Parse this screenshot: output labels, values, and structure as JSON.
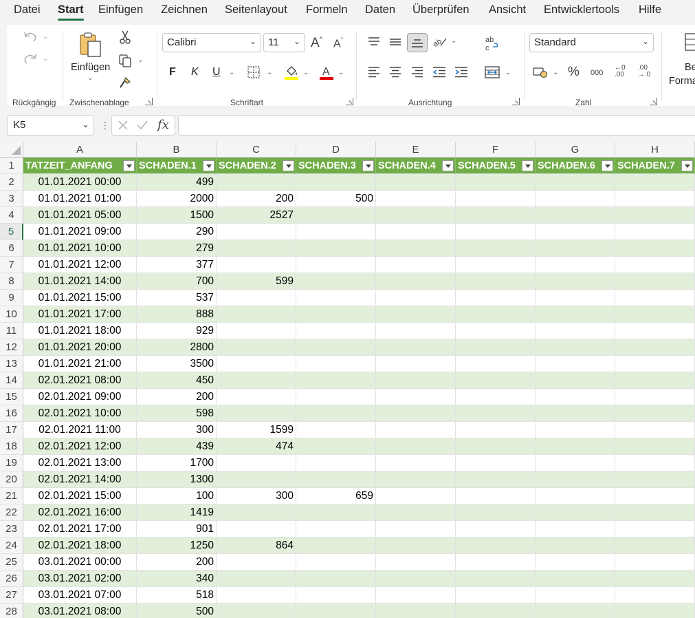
{
  "menu": {
    "tabs": [
      "Datei",
      "Start",
      "Einfügen",
      "Zeichnen",
      "Seitenlayout",
      "Formeln",
      "Daten",
      "Überprüfen",
      "Ansicht",
      "Entwicklertools",
      "Hilfe"
    ],
    "active": "Start"
  },
  "ribbon": {
    "groups": {
      "undo": "Rückgängig",
      "clipboard": "Zwischenablage",
      "font": "Schriftart",
      "alignment": "Ausrichtung",
      "number": "Zahl"
    },
    "paste_label": "Einfügen",
    "font_name": "Calibri",
    "font_size": "11",
    "number_format": "Standard",
    "format_partial_1": "Be",
    "format_partial_2": "Forma",
    "bold": "F",
    "italic": "K",
    "underline": "U",
    "fill_color": "#ffff00",
    "font_color": "#e00000"
  },
  "formula_bar": {
    "name_box": "K5",
    "formula": ""
  },
  "sheet": {
    "columns": [
      "A",
      "B",
      "C",
      "D",
      "E",
      "F",
      "G",
      "H"
    ],
    "headers": [
      "TATZEIT_ANFANG",
      "SCHADEN.1",
      "SCHADEN.2",
      "SCHADEN.3",
      "SCHADEN.4",
      "SCHADEN.5",
      "SCHADEN.6",
      "SCHADEN.7"
    ],
    "selected_row": 5,
    "header_color": "#70ad47",
    "band_color": "#e2efda",
    "rows": [
      {
        "n": "2",
        "a": "01.01.2021 00:00",
        "b": "499",
        "c": "",
        "d": ""
      },
      {
        "n": "3",
        "a": "01.01.2021 01:00",
        "b": "2000",
        "c": "200",
        "d": "500"
      },
      {
        "n": "4",
        "a": "01.01.2021 05:00",
        "b": "1500",
        "c": "2527",
        "d": ""
      },
      {
        "n": "5",
        "a": "01.01.2021 09:00",
        "b": "290",
        "c": "",
        "d": ""
      },
      {
        "n": "6",
        "a": "01.01.2021 10:00",
        "b": "279",
        "c": "",
        "d": ""
      },
      {
        "n": "7",
        "a": "01.01.2021 12:00",
        "b": "377",
        "c": "",
        "d": ""
      },
      {
        "n": "8",
        "a": "01.01.2021 14:00",
        "b": "700",
        "c": "599",
        "d": ""
      },
      {
        "n": "9",
        "a": "01.01.2021 15:00",
        "b": "537",
        "c": "",
        "d": ""
      },
      {
        "n": "10",
        "a": "01.01.2021 17:00",
        "b": "888",
        "c": "",
        "d": ""
      },
      {
        "n": "11",
        "a": "01.01.2021 18:00",
        "b": "929",
        "c": "",
        "d": ""
      },
      {
        "n": "12",
        "a": "01.01.2021 20:00",
        "b": "2800",
        "c": "",
        "d": ""
      },
      {
        "n": "13",
        "a": "01.01.2021 21:00",
        "b": "3500",
        "c": "",
        "d": ""
      },
      {
        "n": "14",
        "a": "02.01.2021 08:00",
        "b": "450",
        "c": "",
        "d": ""
      },
      {
        "n": "15",
        "a": "02.01.2021 09:00",
        "b": "200",
        "c": "",
        "d": ""
      },
      {
        "n": "16",
        "a": "02.01.2021 10:00",
        "b": "598",
        "c": "",
        "d": ""
      },
      {
        "n": "17",
        "a": "02.01.2021 11:00",
        "b": "300",
        "c": "1599",
        "d": ""
      },
      {
        "n": "18",
        "a": "02.01.2021 12:00",
        "b": "439",
        "c": "474",
        "d": ""
      },
      {
        "n": "19",
        "a": "02.01.2021 13:00",
        "b": "1700",
        "c": "",
        "d": ""
      },
      {
        "n": "20",
        "a": "02.01.2021 14:00",
        "b": "1300",
        "c": "",
        "d": ""
      },
      {
        "n": "21",
        "a": "02.01.2021 15:00",
        "b": "100",
        "c": "300",
        "d": "659"
      },
      {
        "n": "22",
        "a": "02.01.2021 16:00",
        "b": "1419",
        "c": "",
        "d": ""
      },
      {
        "n": "23",
        "a": "02.01.2021 17:00",
        "b": "901",
        "c": "",
        "d": ""
      },
      {
        "n": "24",
        "a": "02.01.2021 18:00",
        "b": "1250",
        "c": "864",
        "d": ""
      },
      {
        "n": "25",
        "a": "03.01.2021 00:00",
        "b": "200",
        "c": "",
        "d": ""
      },
      {
        "n": "26",
        "a": "03.01.2021 02:00",
        "b": "340",
        "c": "",
        "d": ""
      },
      {
        "n": "27",
        "a": "03.01.2021 07:00",
        "b": "518",
        "c": "",
        "d": ""
      },
      {
        "n": "28",
        "a": "03.01.2021 08:00",
        "b": "500",
        "c": "",
        "d": ""
      }
    ]
  }
}
